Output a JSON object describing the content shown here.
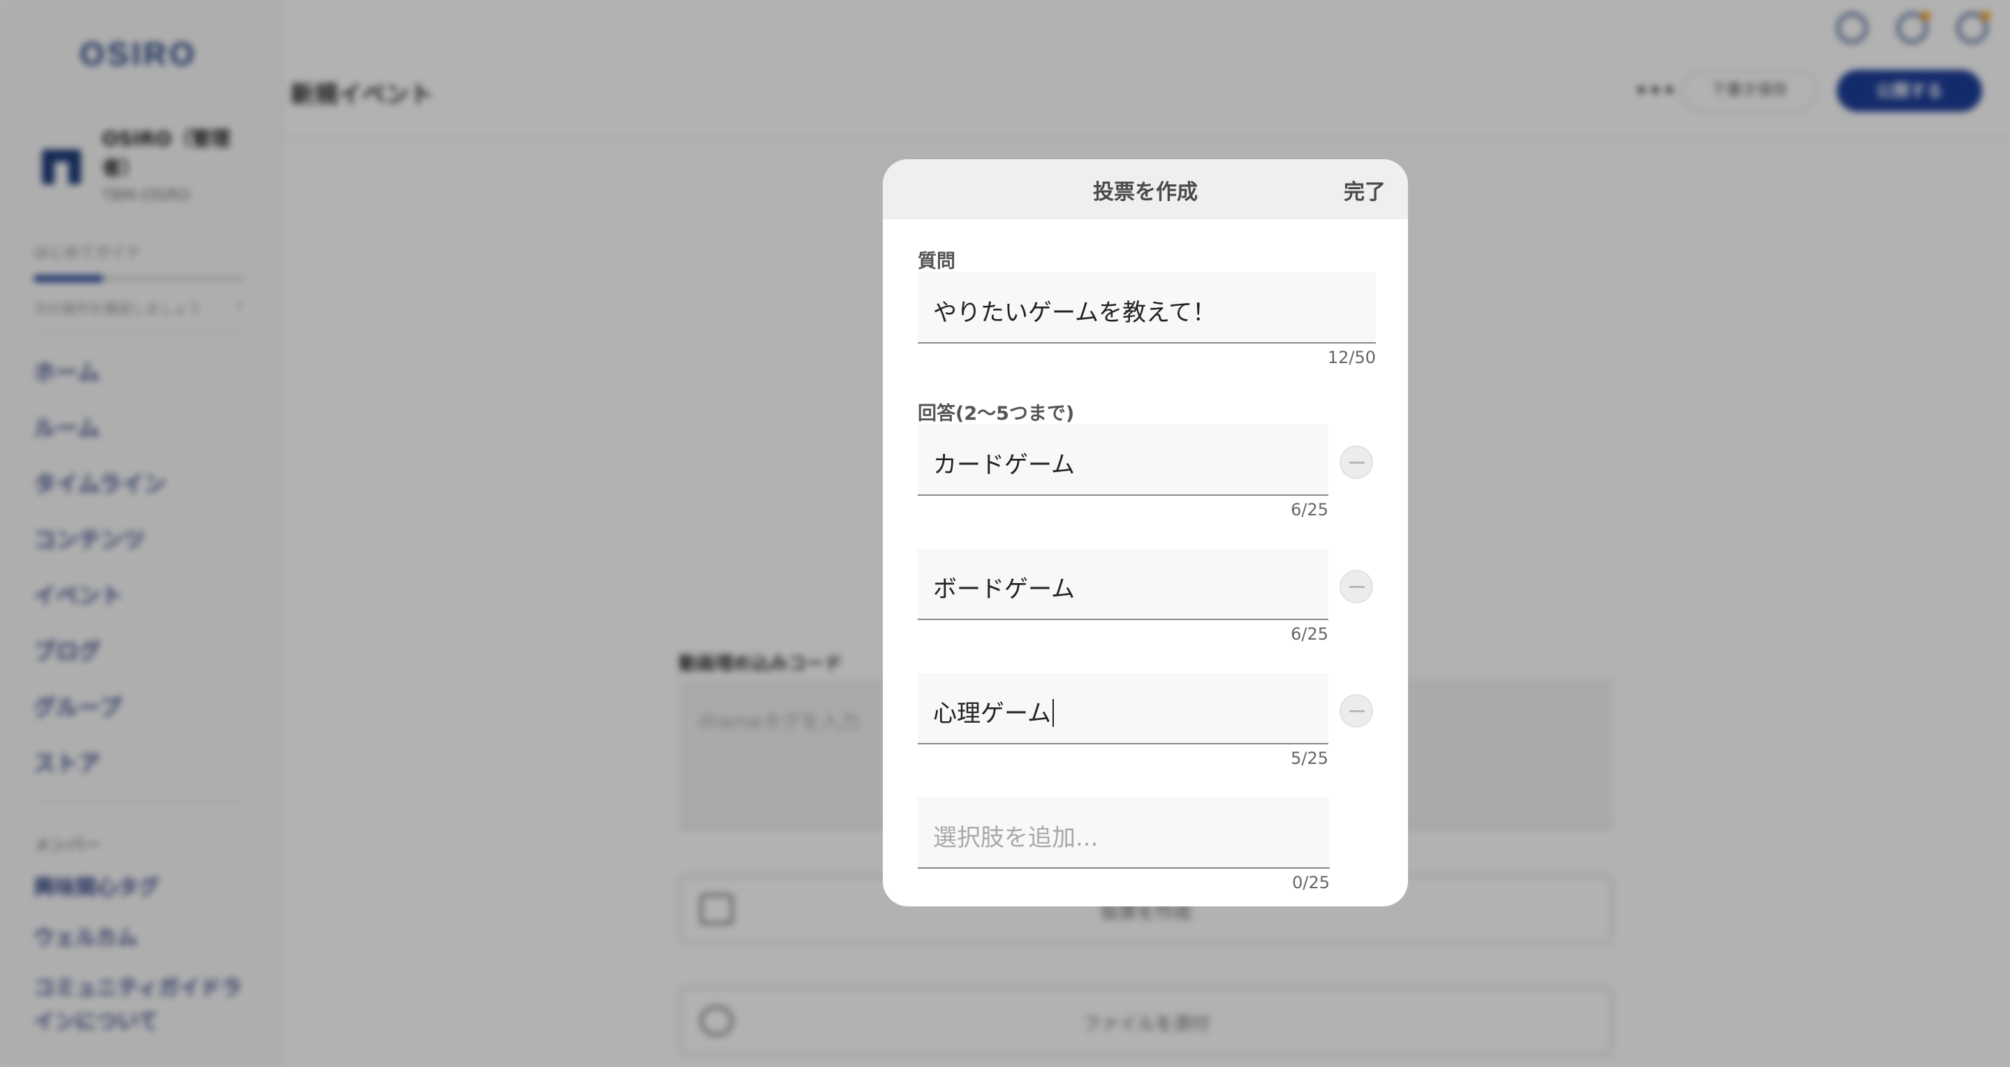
{
  "app": {
    "logo": "OSIRO",
    "org": {
      "name": "OSIRO（管理者）",
      "id": "TBM-OSIRO"
    },
    "guide": {
      "title": "はじめてガイド",
      "subtitle": "次の操作を確認しましょう",
      "progress": 0.33
    },
    "nav": [
      "ホーム",
      "ルーム",
      "タイムライン",
      "コンテンツ",
      "イベント",
      "ブログ",
      "グループ",
      "ストア"
    ],
    "members_title": "メンバー",
    "nav2": [
      "興味関心タグ",
      "ウェルカム",
      "コミュニティガイドラインについて"
    ],
    "page_title": "新規イベント",
    "more": "•••",
    "draft_label": "下書き保存",
    "publish_label": "公開する",
    "embed": {
      "label": "動画埋め込みコード",
      "placeholder": "iframeタグを入力"
    },
    "actions": [
      "投票を作成",
      "ファイルを添付"
    ]
  },
  "modal": {
    "title": "投票を作成",
    "done_label": "完了",
    "question": {
      "label": "質問",
      "value": "やりたいゲームを教えて！",
      "counter": "12/50"
    },
    "answers_label": "回答(2〜5つまで)",
    "answers": [
      {
        "value": "カードゲーム",
        "counter": "6/25"
      },
      {
        "value": "ボードゲーム",
        "counter": "6/25"
      },
      {
        "value": "心理ゲーム",
        "counter": "5/25"
      }
    ],
    "add_option": {
      "placeholder": "選択肢を追加...",
      "counter": "0/25"
    }
  }
}
